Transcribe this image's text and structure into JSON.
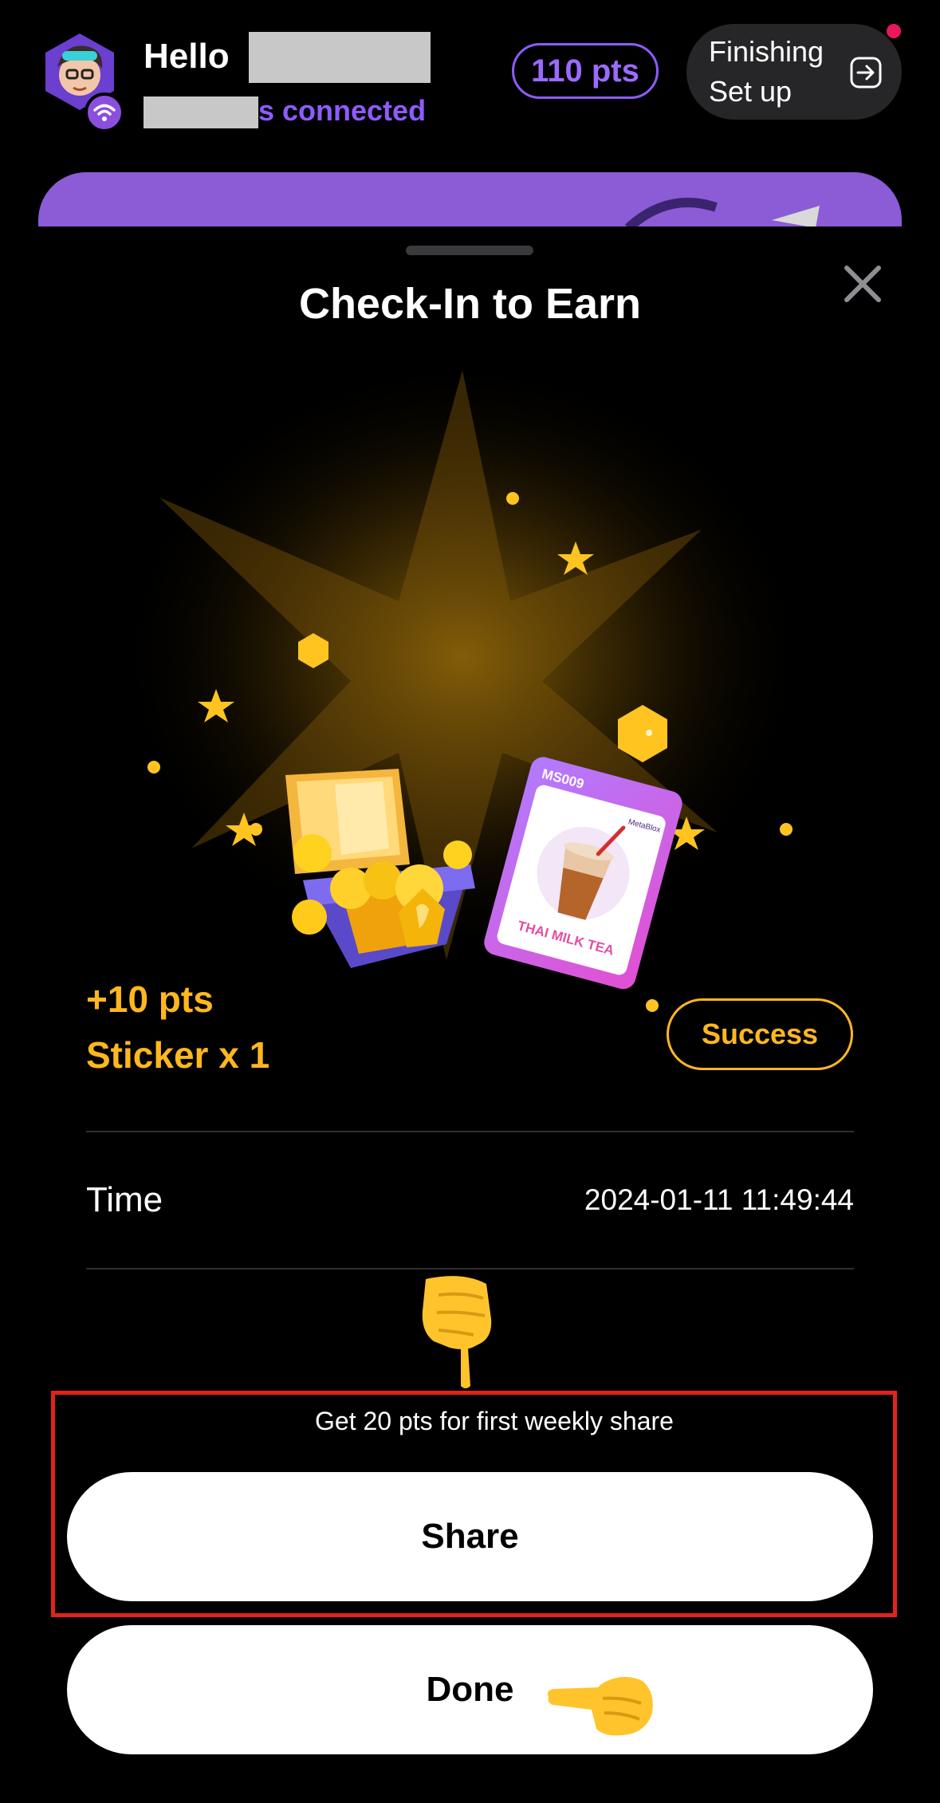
{
  "header": {
    "greeting": "Hello",
    "wifi_status": "s connected",
    "points_badge": "110 pts",
    "setup_button": "Finishing\nSet up"
  },
  "sheet": {
    "title": "Check-In to Earn",
    "card": {
      "code": "MS009",
      "brand": "MetaBlox",
      "name": "THAI MILK TEA"
    },
    "rewards": {
      "points": "+10 pts",
      "sticker": "Sticker x 1",
      "status": "Success"
    },
    "time_label": "Time",
    "time_value": "2024-01-11 11:49:44",
    "share_note": "Get 20 pts for first weekly share",
    "share_button": "Share",
    "done_button": "Done"
  },
  "colors": {
    "accent_purple": "#8f5bff",
    "reward_gold": "#ffb71f",
    "highlight_red": "#e2231a",
    "notification": "#e8185a"
  },
  "icons": [
    "avatar",
    "wifi-icon",
    "exit-arrow-icon",
    "close-icon",
    "treasure-chest-icon",
    "sticker-card",
    "hand-point-down-icon",
    "hand-point-left-icon"
  ]
}
